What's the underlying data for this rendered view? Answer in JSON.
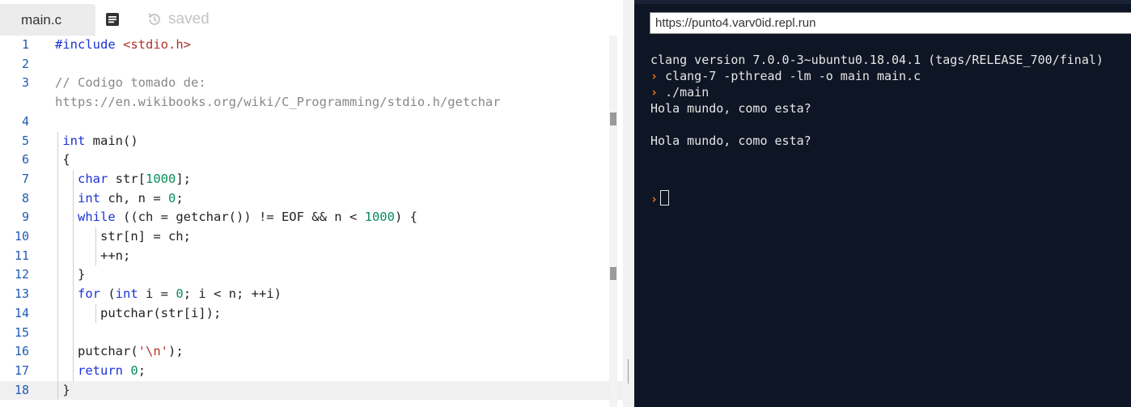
{
  "editor": {
    "tab": {
      "filename": "main.c"
    },
    "status": {
      "saved_label": "saved"
    },
    "lines": [
      {
        "n": "1",
        "tokens": [
          {
            "t": "#include ",
            "c": "kw"
          },
          {
            "t": "<stdio.h>",
            "c": "str"
          }
        ]
      },
      {
        "n": "2",
        "tokens": []
      },
      {
        "n": "3",
        "tokens": [
          {
            "t": "// Codigo tomado de:",
            "c": "cm"
          }
        ]
      },
      {
        "n": "",
        "tokens": [
          {
            "t": "https://en.wikibooks.org/wiki/C_Programming/stdio.h/getchar",
            "c": "cm"
          }
        ]
      },
      {
        "n": "4",
        "tokens": []
      },
      {
        "n": "5",
        "tokens": [
          {
            "t": " "
          },
          {
            "t": "int",
            "c": "kw"
          },
          {
            "t": " main()"
          }
        ]
      },
      {
        "n": "6",
        "tokens": [
          {
            "t": " {"
          }
        ]
      },
      {
        "n": "7",
        "tokens": [
          {
            "t": "   "
          },
          {
            "t": "char",
            "c": "kw"
          },
          {
            "t": " str["
          },
          {
            "t": "1000",
            "c": "num"
          },
          {
            "t": "];"
          }
        ]
      },
      {
        "n": "8",
        "tokens": [
          {
            "t": "   "
          },
          {
            "t": "int",
            "c": "kw"
          },
          {
            "t": " ch, n = "
          },
          {
            "t": "0",
            "c": "num"
          },
          {
            "t": ";"
          }
        ]
      },
      {
        "n": "9",
        "tokens": [
          {
            "t": "   "
          },
          {
            "t": "while",
            "c": "kw"
          },
          {
            "t": " ((ch = getchar()) != EOF && n < "
          },
          {
            "t": "1000",
            "c": "num"
          },
          {
            "t": ") {"
          }
        ]
      },
      {
        "n": "10",
        "tokens": [
          {
            "t": "      str[n] = ch;"
          }
        ]
      },
      {
        "n": "11",
        "tokens": [
          {
            "t": "      ++n;"
          }
        ]
      },
      {
        "n": "12",
        "tokens": [
          {
            "t": "   }"
          }
        ]
      },
      {
        "n": "13",
        "tokens": [
          {
            "t": "   "
          },
          {
            "t": "for",
            "c": "kw"
          },
          {
            "t": " ("
          },
          {
            "t": "int",
            "c": "kw"
          },
          {
            "t": " i = "
          },
          {
            "t": "0",
            "c": "num"
          },
          {
            "t": "; i < n; ++i)"
          }
        ]
      },
      {
        "n": "14",
        "tokens": [
          {
            "t": "      putchar(str[i]);"
          }
        ]
      },
      {
        "n": "15",
        "tokens": []
      },
      {
        "n": "16",
        "tokens": [
          {
            "t": "   putchar("
          },
          {
            "t": "'\\n'",
            "c": "str"
          },
          {
            "t": ");"
          }
        ]
      },
      {
        "n": "17",
        "tokens": [
          {
            "t": "   "
          },
          {
            "t": "return",
            "c": "kw"
          },
          {
            "t": " "
          },
          {
            "t": "0",
            "c": "num"
          },
          {
            "t": ";"
          }
        ]
      },
      {
        "n": "18",
        "tokens": [
          {
            "t": " }"
          }
        ],
        "active": true
      }
    ]
  },
  "console": {
    "url": "https://punto4.varv0id.repl.run",
    "prompt_symbol": "›",
    "lines": [
      {
        "text": "clang version 7.0.0-3~ubuntu0.18.04.1 (tags/RELEASE_700/final)",
        "prompt": false
      },
      {
        "text": "clang-7 -pthread -lm -o main main.c",
        "prompt": true
      },
      {
        "text": "./main",
        "prompt": true
      },
      {
        "text": "Hola mundo, como esta?",
        "prompt": false
      },
      {
        "text": "",
        "prompt": false
      },
      {
        "text": "Hola mundo, como esta?",
        "prompt": false
      }
    ]
  },
  "colors": {
    "keyword": "#1a33d6",
    "number": "#0a8c5a",
    "string": "#b0332b",
    "comment": "#888888",
    "console_bg": "#0e1524",
    "prompt": "#f07a1d"
  }
}
